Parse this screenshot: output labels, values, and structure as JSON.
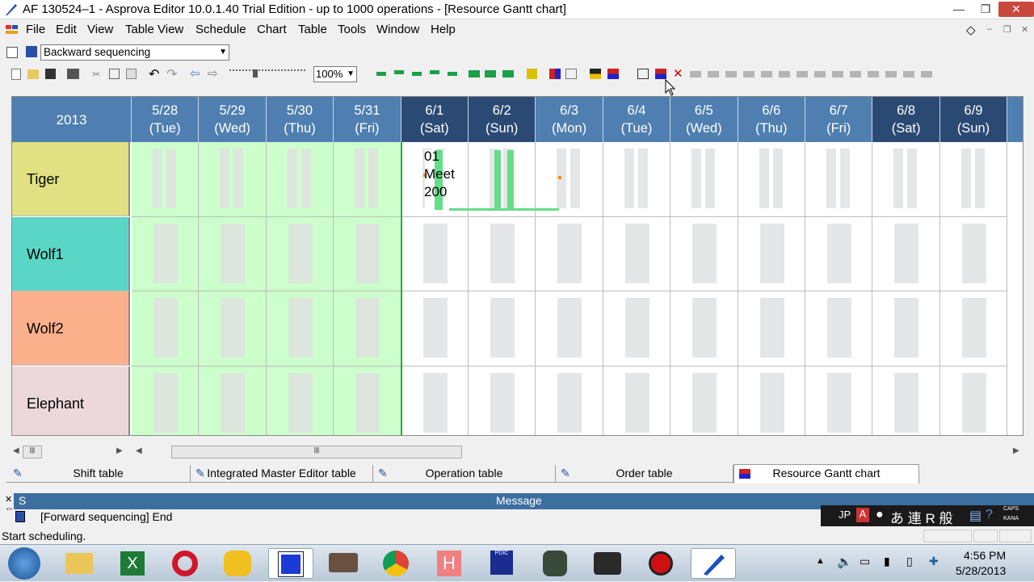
{
  "window": {
    "title": "AF 130524–1 - Asprova Editor 10.0.1.40 Trial Edition  - up to 1000 operations - [Resource Gantt chart]"
  },
  "menu": [
    "File",
    "Edit",
    "View",
    "Table View",
    "Schedule",
    "Chart",
    "Table",
    "Tools",
    "Window",
    "Help"
  ],
  "toolbar": {
    "sequencing_value": "Backward sequencing",
    "zoom_value": "100%"
  },
  "gantt": {
    "year": "2013",
    "dates": [
      {
        "d": "5/28",
        "w": "(Tue)",
        "weekend": false
      },
      {
        "d": "5/29",
        "w": "(Wed)",
        "weekend": false
      },
      {
        "d": "5/30",
        "w": "(Thu)",
        "weekend": false
      },
      {
        "d": "5/31",
        "w": "(Fri)",
        "weekend": false
      },
      {
        "d": "6/1",
        "w": "(Sat)",
        "weekend": true
      },
      {
        "d": "6/2",
        "w": "(Sun)",
        "weekend": true
      },
      {
        "d": "6/3",
        "w": "(Mon)",
        "weekend": false
      },
      {
        "d": "6/4",
        "w": "(Tue)",
        "weekend": false
      },
      {
        "d": "6/5",
        "w": "(Wed)",
        "weekend": false
      },
      {
        "d": "6/6",
        "w": "(Thu)",
        "weekend": false
      },
      {
        "d": "6/7",
        "w": "(Fri)",
        "weekend": false
      },
      {
        "d": "6/8",
        "w": "(Sat)",
        "weekend": true
      },
      {
        "d": "6/9",
        "w": "(Sun)",
        "weekend": true
      }
    ],
    "resources": [
      {
        "name": "Tiger",
        "color": "#e1e183"
      },
      {
        "name": "Wolf1",
        "color": "#5ad6c6"
      },
      {
        "name": "Wolf2",
        "color": "#fbb08c"
      },
      {
        "name": "Elephant",
        "color": "#ecd8da"
      }
    ],
    "operation_label": [
      "01",
      "Meet",
      "200"
    ]
  },
  "tabs": [
    "Shift table",
    "Integrated Master Editor table",
    "Operation table",
    "Order table",
    "Resource Gantt chart"
  ],
  "messages": {
    "title": "Message",
    "pane_label": "S",
    "line": "[Forward sequencing] End"
  },
  "status": "Start scheduling.",
  "ime": {
    "lang": "JP",
    "chars": "あ 連 R 般",
    "caps": "CAPS",
    "kana": "KANA"
  },
  "clock": {
    "time": "4:56 PM",
    "date": "5/28/2013"
  }
}
